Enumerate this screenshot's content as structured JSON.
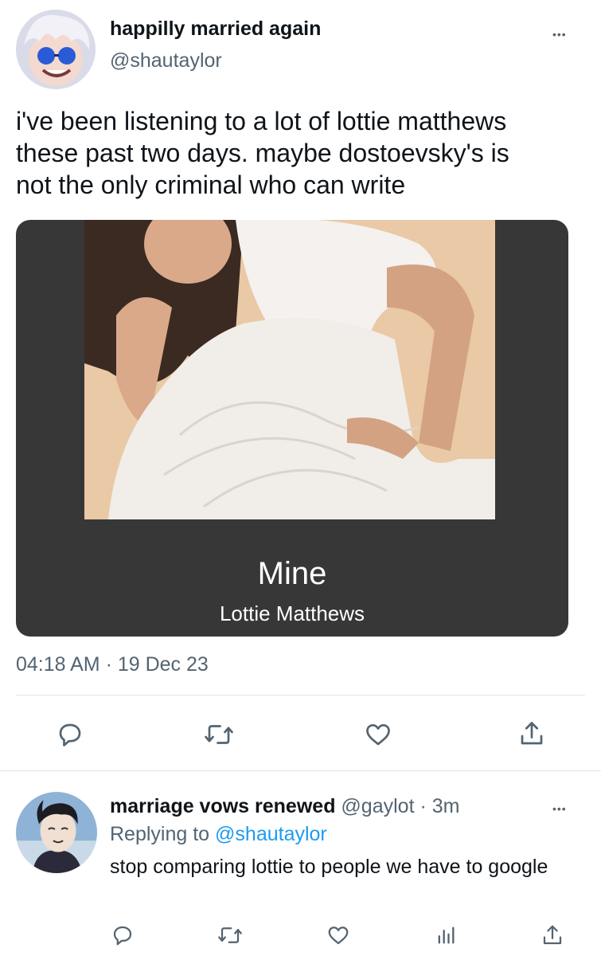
{
  "tweet": {
    "author_name": "happilly married again",
    "author_handle": "@shautaylor",
    "text": "i've been listening to a lot of lottie matthews\nthese past two days. maybe dostoevsky's is\nnot the only criminal who can write",
    "card": {
      "song_title": "Mine",
      "artist": "Lottie Matthews"
    },
    "timestamp": "04:18 AM · 19 Dec 23",
    "actions": {
      "reply_icon": "speech-bubble-icon",
      "retweet_icon": "retweet-icon",
      "like_icon": "heart-icon",
      "share_icon": "share-icon"
    },
    "more_icon": "more-dots-icon",
    "more_glyph": "•••"
  },
  "reply": {
    "author_name": "marriage vows renewed",
    "author_handle": "@gaylot",
    "time_ago": "3m",
    "separator": "·",
    "replying_to_label": "Replying to",
    "replying_to_handle": "@shautaylor",
    "text": "stop comparing lottie to people we have to google",
    "actions": {
      "reply_icon": "speech-bubble-icon",
      "retweet_icon": "retweet-icon",
      "like_icon": "heart-icon",
      "analytics_icon": "analytics-icon",
      "share_icon": "share-icon"
    },
    "more_glyph": "•••"
  },
  "colors": {
    "text_primary": "#0f1419",
    "text_secondary": "#536471",
    "link": "#1d9bf0",
    "card_background": "#373737",
    "divider": "#e1e6ea"
  }
}
